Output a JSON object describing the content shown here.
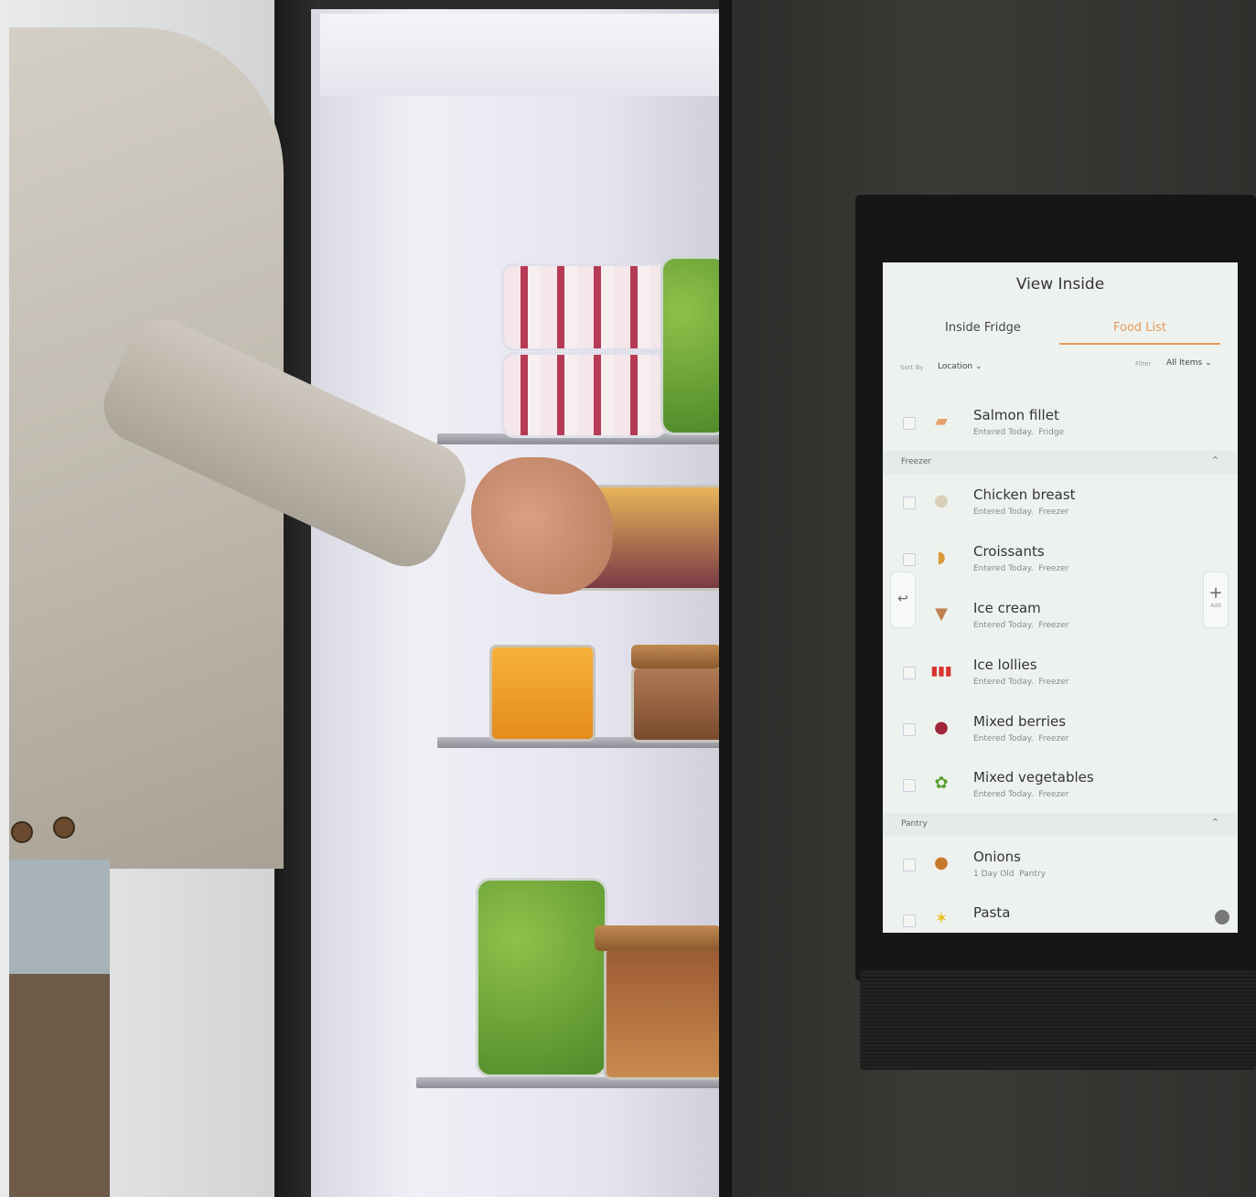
{
  "screen": {
    "title": "View Inside",
    "tabs": [
      {
        "label": "Inside Fridge",
        "active": false
      },
      {
        "label": "Food List",
        "active": true
      }
    ],
    "accent_color": "#e69a5a",
    "sort": {
      "label": "Sort By",
      "value": "Location"
    },
    "filter": {
      "label": "Filter",
      "value": "All Items"
    },
    "add_button_label": "Add",
    "items_fridge": [
      {
        "name": "Salmon fillet",
        "entered": "Entered Today.",
        "location": "Fridge",
        "icon": "salmon-icon"
      }
    ],
    "freezer": {
      "label": "Freezer",
      "items": [
        {
          "name": "Chicken breast",
          "entered": "Entered Today.",
          "location": "Freezer",
          "icon": "chicken-icon"
        },
        {
          "name": "Croissants",
          "entered": "Entered Today.",
          "location": "Freezer",
          "icon": "croissant-icon"
        },
        {
          "name": "Ice cream",
          "entered": "Entered Today.",
          "location": "Freezer",
          "icon": "ice-cream-icon"
        },
        {
          "name": "Ice lollies",
          "entered": "Entered Today.",
          "location": "Freezer",
          "icon": "ice-lolly-icon"
        },
        {
          "name": "Mixed berries",
          "entered": "Entered Today.",
          "location": "Freezer",
          "icon": "berries-icon"
        },
        {
          "name": "Mixed vegetables",
          "entered": "Entered Today.",
          "location": "Freezer",
          "icon": "vegetables-icon"
        }
      ]
    },
    "pantry": {
      "label": "Pantry",
      "items": [
        {
          "name": "Onions",
          "entered": "1 Day Old",
          "location": "Pantry",
          "icon": "onion-icon"
        },
        {
          "name": "Pasta",
          "entered": "",
          "location": "",
          "icon": "pasta-icon"
        }
      ]
    }
  }
}
